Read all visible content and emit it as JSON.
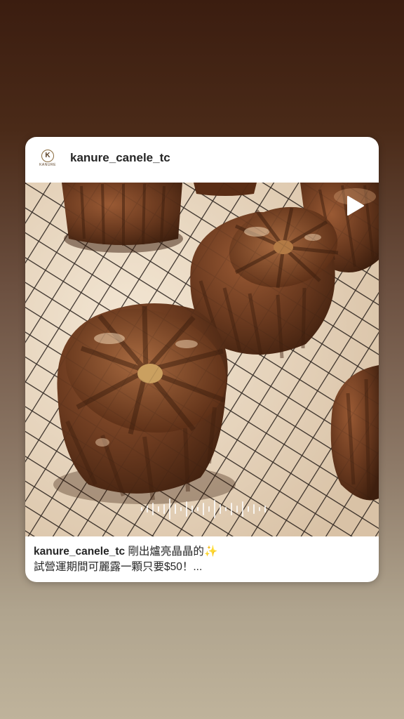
{
  "post": {
    "username": "kanure_canele_tc",
    "avatar": {
      "letter": "K",
      "brand_text": "KANURE"
    },
    "caption": {
      "username": "kanure_canele_tc",
      "line1": "剛出爐亮晶晶的",
      "emoji": "✨",
      "line2": "試營運期間可麗露一顆只要$50！..."
    },
    "media": {
      "type": "video",
      "play_icon": "play-icon",
      "audio_icon": "waveform-icon"
    }
  },
  "colors": {
    "background_top": "#3b1d10",
    "background_bottom": "#bfb39b",
    "card": "#ffffff",
    "text": "#262626",
    "canele": "#6b3a1f"
  }
}
